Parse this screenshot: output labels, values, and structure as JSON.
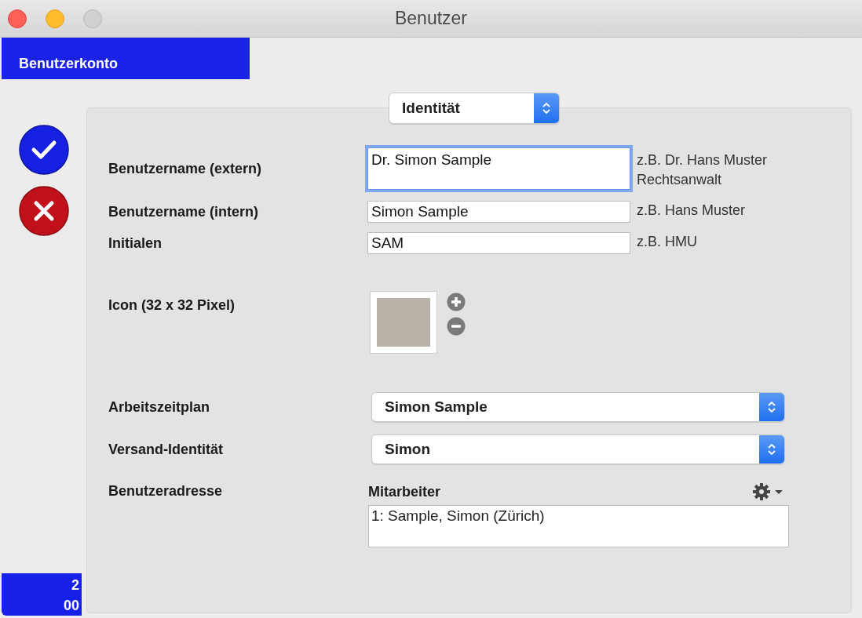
{
  "window": {
    "title": "Benutzer"
  },
  "tab": {
    "label": "Benutzerkonto",
    "selected": true
  },
  "section_select": {
    "value": "Identität"
  },
  "fields": [
    {
      "label": "Benutzername (extern)",
      "value": "Dr. Simon Sample",
      "hint": "z.B. Dr. Hans Muster Rechtsanwalt",
      "focused": true,
      "kind": "tall"
    },
    {
      "label": "Benutzername (intern)",
      "value": "Simon Sample",
      "hint": "z.B. Hans Muster",
      "focused": false,
      "kind": "line"
    },
    {
      "label": "Initialen",
      "value": "SAM",
      "hint": "z.B. HMU",
      "focused": false,
      "kind": "line"
    }
  ],
  "icon_field": {
    "label": "Icon (32 x 32 Pixel)"
  },
  "selects": [
    {
      "label": "Arbeitszeitplan",
      "value": "Simon Sample"
    },
    {
      "label": "Versand-Identität",
      "value": "Simon"
    }
  ],
  "address": {
    "label": "Benutzeradresse",
    "list_title": "Mitarbeiter",
    "items": [
      "1: Sample, Simon (Zürich)"
    ]
  },
  "counter": "2\n00"
}
